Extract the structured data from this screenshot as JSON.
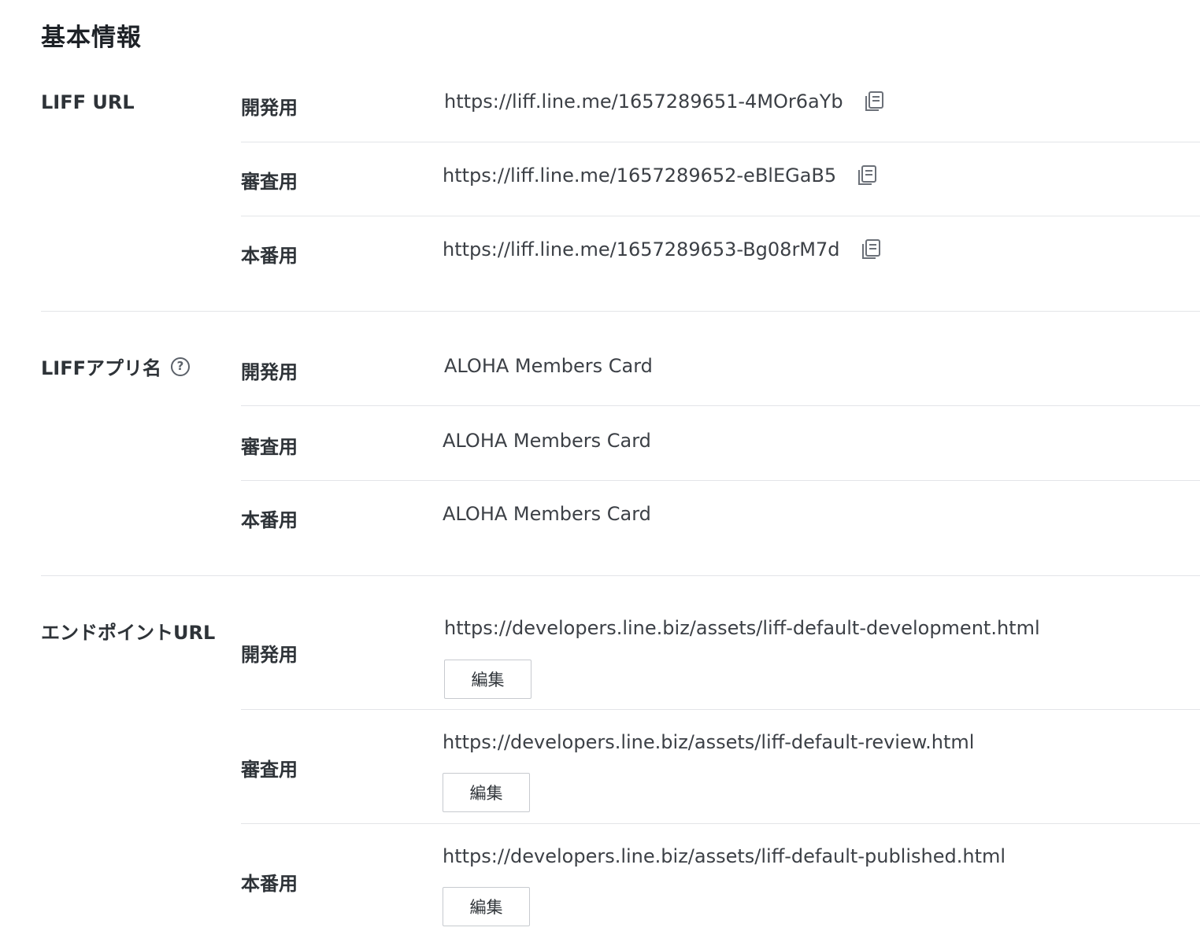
{
  "section": {
    "title": "基本情報"
  },
  "liff_url": {
    "label": "LIFF URL",
    "rows": [
      {
        "env": "開発用",
        "value": "https://liff.line.me/1657289651-4MOr6aYb",
        "icon": "copy-icon"
      },
      {
        "env": "審査用",
        "value": "https://liff.line.me/1657289652-eBlEGaB5",
        "icon": "copy-icon"
      },
      {
        "env": "本番用",
        "value": "https://liff.line.me/1657289653-Bg08rM7d",
        "icon": "copy-icon"
      }
    ]
  },
  "liff_app_name": {
    "label": "LIFFアプリ名",
    "help_icon": "?",
    "rows": [
      {
        "env": "開発用",
        "value": "ALOHA Members Card"
      },
      {
        "env": "審査用",
        "value": "ALOHA Members Card"
      },
      {
        "env": "本番用",
        "value": "ALOHA Members Card"
      }
    ]
  },
  "endpoint_url": {
    "label": "エンドポイントURL",
    "rows": [
      {
        "env": "開発用",
        "value": "https://developers.line.biz/assets/liff-default-development.html",
        "button": "編集"
      },
      {
        "env": "審査用",
        "value": "https://developers.line.biz/assets/liff-default-review.html",
        "button": "編集"
      },
      {
        "env": "本番用",
        "value": "https://developers.line.biz/assets/liff-default-published.html",
        "button": "編集"
      }
    ]
  },
  "colors": {
    "text": "#2e3338",
    "value_text": "#3c4046",
    "divider": "#e3e5e8",
    "icon": "#6b7078"
  }
}
